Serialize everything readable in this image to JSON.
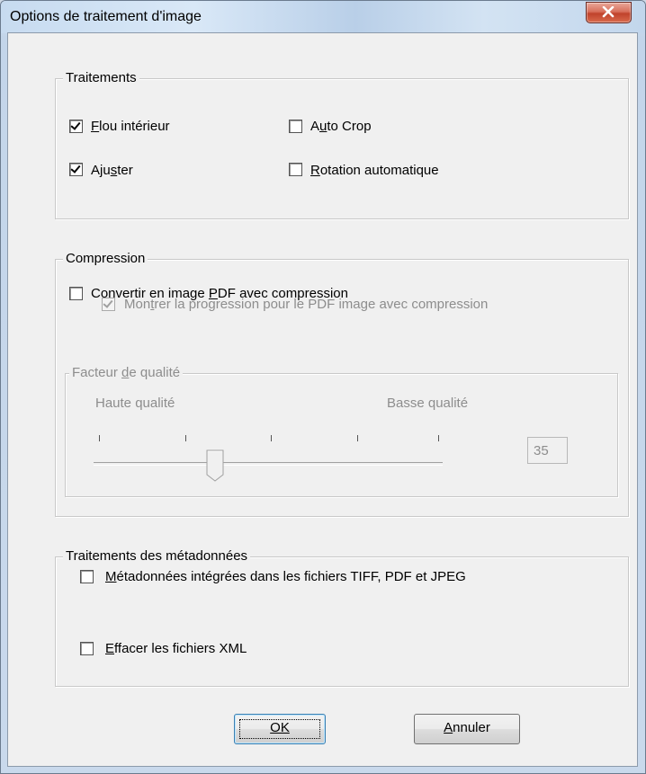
{
  "window": {
    "title": "Options de traitement d'image"
  },
  "traitements": {
    "label": "Traitements",
    "flou": {
      "label": "Flou intérieur",
      "checked": true
    },
    "ajuster": {
      "label": "Ajuster",
      "checked": true
    },
    "autocrop": {
      "label": "Auto Crop",
      "checked": false
    },
    "rotation": {
      "label": "Rotation automatique",
      "checked": false
    }
  },
  "compression": {
    "label": "Compression",
    "convertir": {
      "label": "Convertir en image PDF avec compression",
      "checked": false
    },
    "montrer": {
      "label": "Montrer la progression pour le PDF image avec compression",
      "checked": true,
      "disabled": true
    },
    "facteur": {
      "label": "Facteur de qualité",
      "haute": "Haute qualité",
      "basse": "Basse qualité",
      "value": "35"
    }
  },
  "metadonnees": {
    "label": "Traitements des métadonnées",
    "integrees": {
      "label": "Métadonnées intégrées dans les fichiers TIFF, PDF et JPEG",
      "checked": false
    },
    "effacer": {
      "label": "Effacer les fichiers XML",
      "checked": false
    }
  },
  "buttons": {
    "ok": "OK",
    "annuler": "Annuler"
  },
  "colors": {
    "close": "#c8452e",
    "disabled_text": "#8d8d8d"
  }
}
